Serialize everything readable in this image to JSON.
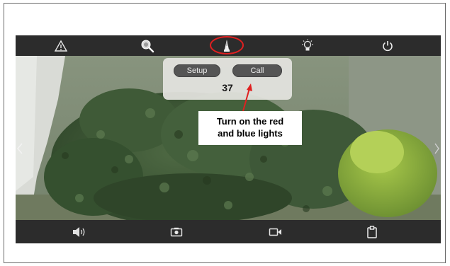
{
  "top_toolbar": {
    "icons": [
      "warning-icon",
      "zoom-icon",
      "beacon-light-icon",
      "light-bulb-icon",
      "power-icon"
    ]
  },
  "bottom_toolbar": {
    "icons": [
      "speaker-icon",
      "camera-icon",
      "video-icon",
      "clipboard-icon"
    ]
  },
  "popup": {
    "setup_label": "Setup",
    "call_label": "Call",
    "value": "37"
  },
  "annotation": {
    "line1": "Turn on the red",
    "line2": "and blue lights"
  },
  "colors": {
    "toolbar_bg": "#2c2c2c",
    "highlight": "#e02020",
    "pill_bg": "#555555",
    "popup_bg": "#e4e4e0"
  }
}
